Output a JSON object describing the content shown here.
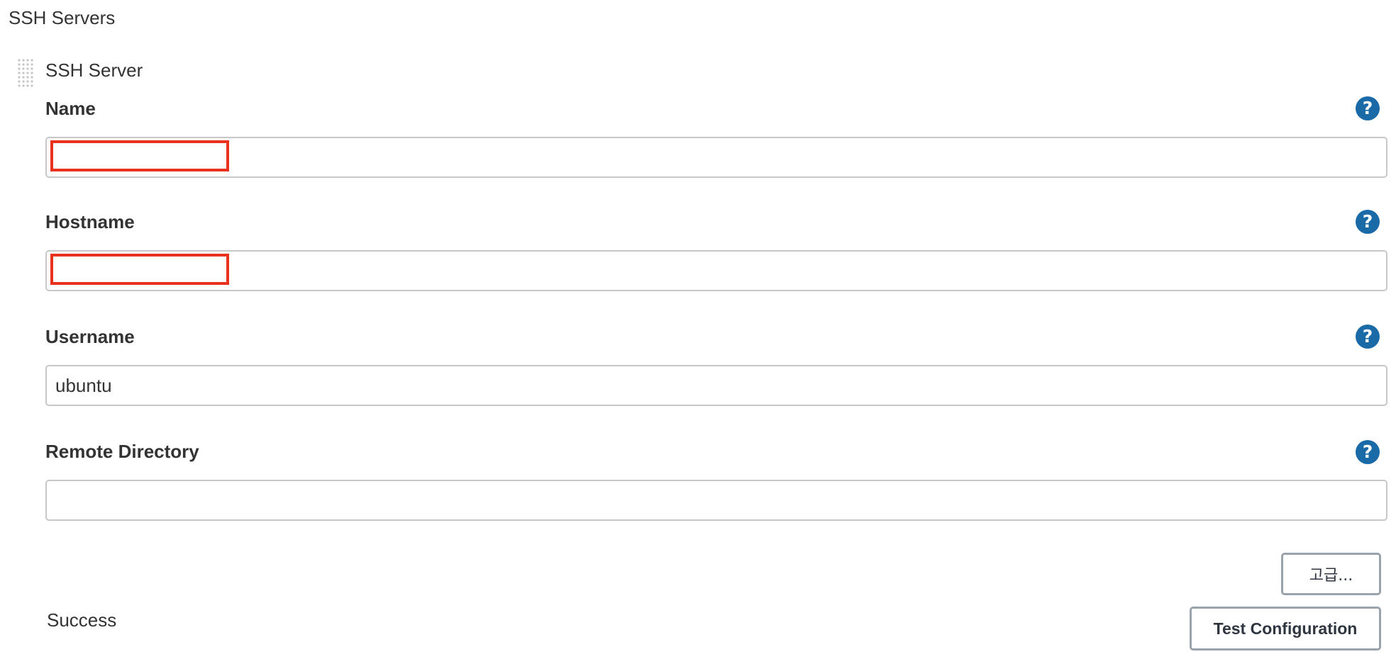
{
  "section": {
    "title": "SSH Servers"
  },
  "server": {
    "block_title": "SSH Server",
    "fields": [
      {
        "label": "Name",
        "value": "",
        "redacted": true,
        "help_icon": "question-mark-icon"
      },
      {
        "label": "Hostname",
        "value": "",
        "redacted": true,
        "help_icon": "question-mark-icon"
      },
      {
        "label": "Username",
        "value": "ubuntu",
        "redacted": false,
        "help_icon": "question-mark-icon"
      },
      {
        "label": "Remote Directory",
        "value": "",
        "redacted": false,
        "help_icon": "question-mark-icon"
      }
    ],
    "help_glyph": "?",
    "advanced_button_label": "고급...",
    "test_button_label": "Test Configuration",
    "status_text": "Success"
  },
  "colors": {
    "help_icon_bg": "#1b6aa8",
    "redaction_border": "#e8321e",
    "input_border": "#c8c8c8",
    "button_border": "#9aa2ab"
  }
}
